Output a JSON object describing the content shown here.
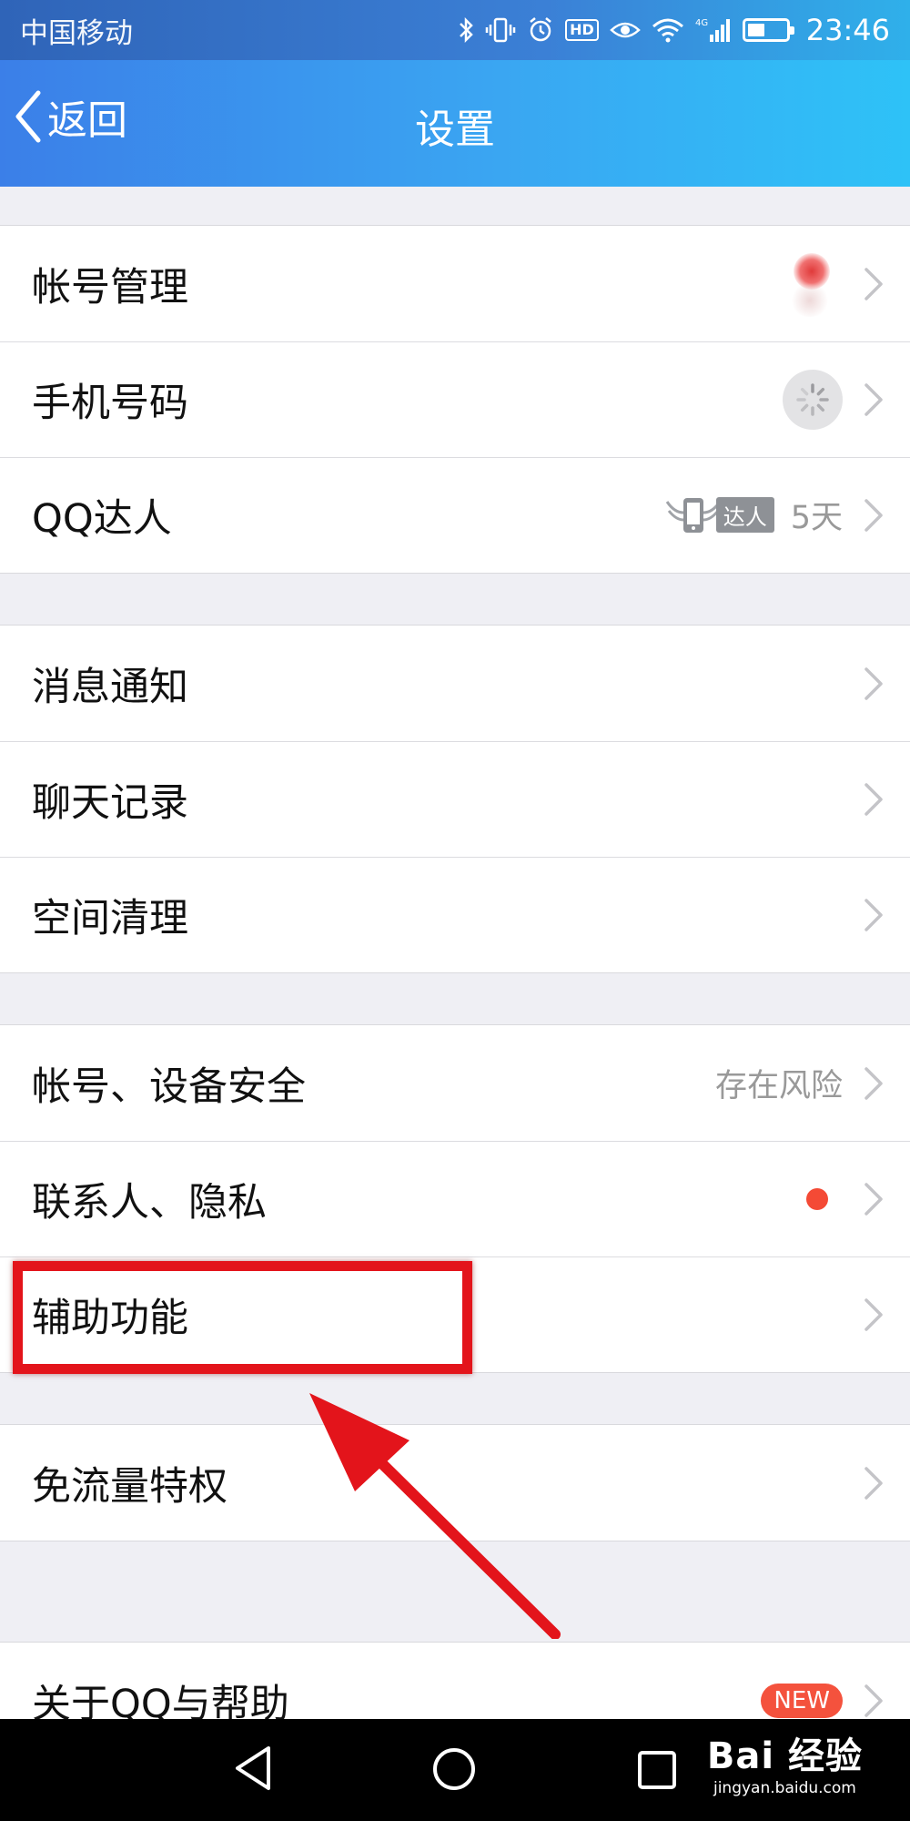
{
  "status_bar": {
    "carrier": "中国移动",
    "hd_label": "HD",
    "network_label": "4G",
    "time": "23:46",
    "battery_level": 0.45,
    "icons": [
      "bluetooth-icon",
      "vibrate-icon",
      "alarm-icon",
      "hd-icon",
      "eye-icon",
      "wifi-icon",
      "signal-icon",
      "battery-icon"
    ]
  },
  "nav": {
    "back_label": "返回",
    "title": "设置"
  },
  "groups": [
    {
      "items": [
        {
          "label": "帐号管理",
          "accessory": "avatar"
        },
        {
          "label": "手机号码",
          "accessory": "loading"
        },
        {
          "label": "QQ达人",
          "badge_text": "达人",
          "value": "5天"
        }
      ]
    },
    {
      "items": [
        {
          "label": "消息通知"
        },
        {
          "label": "聊天记录"
        },
        {
          "label": "空间清理"
        }
      ]
    },
    {
      "items": [
        {
          "label": "帐号、设备安全",
          "value": "存在风险"
        },
        {
          "label": "联系人、隐私",
          "accessory": "red-dot"
        },
        {
          "label": "辅助功能",
          "highlighted": true
        }
      ]
    },
    {
      "items": [
        {
          "label": "免流量特权"
        }
      ]
    },
    {
      "items": [
        {
          "label": "关于QQ与帮助",
          "badge_text": "NEW"
        }
      ]
    }
  ],
  "annotation": {
    "highlight_color": "#e3141b"
  },
  "bottom_nav": {
    "buttons": [
      "back-triangle-icon",
      "home-circle-icon",
      "recents-square-icon"
    ]
  },
  "watermark": {
    "brand": "Bai 经验",
    "url": "jingyan.baidu.com"
  },
  "colors": {
    "header_start": "#3b7fe8",
    "header_end": "#2ec2f7",
    "background": "#efeff4",
    "red_dot": "#f44a35",
    "new_badge": "#f4523d"
  }
}
